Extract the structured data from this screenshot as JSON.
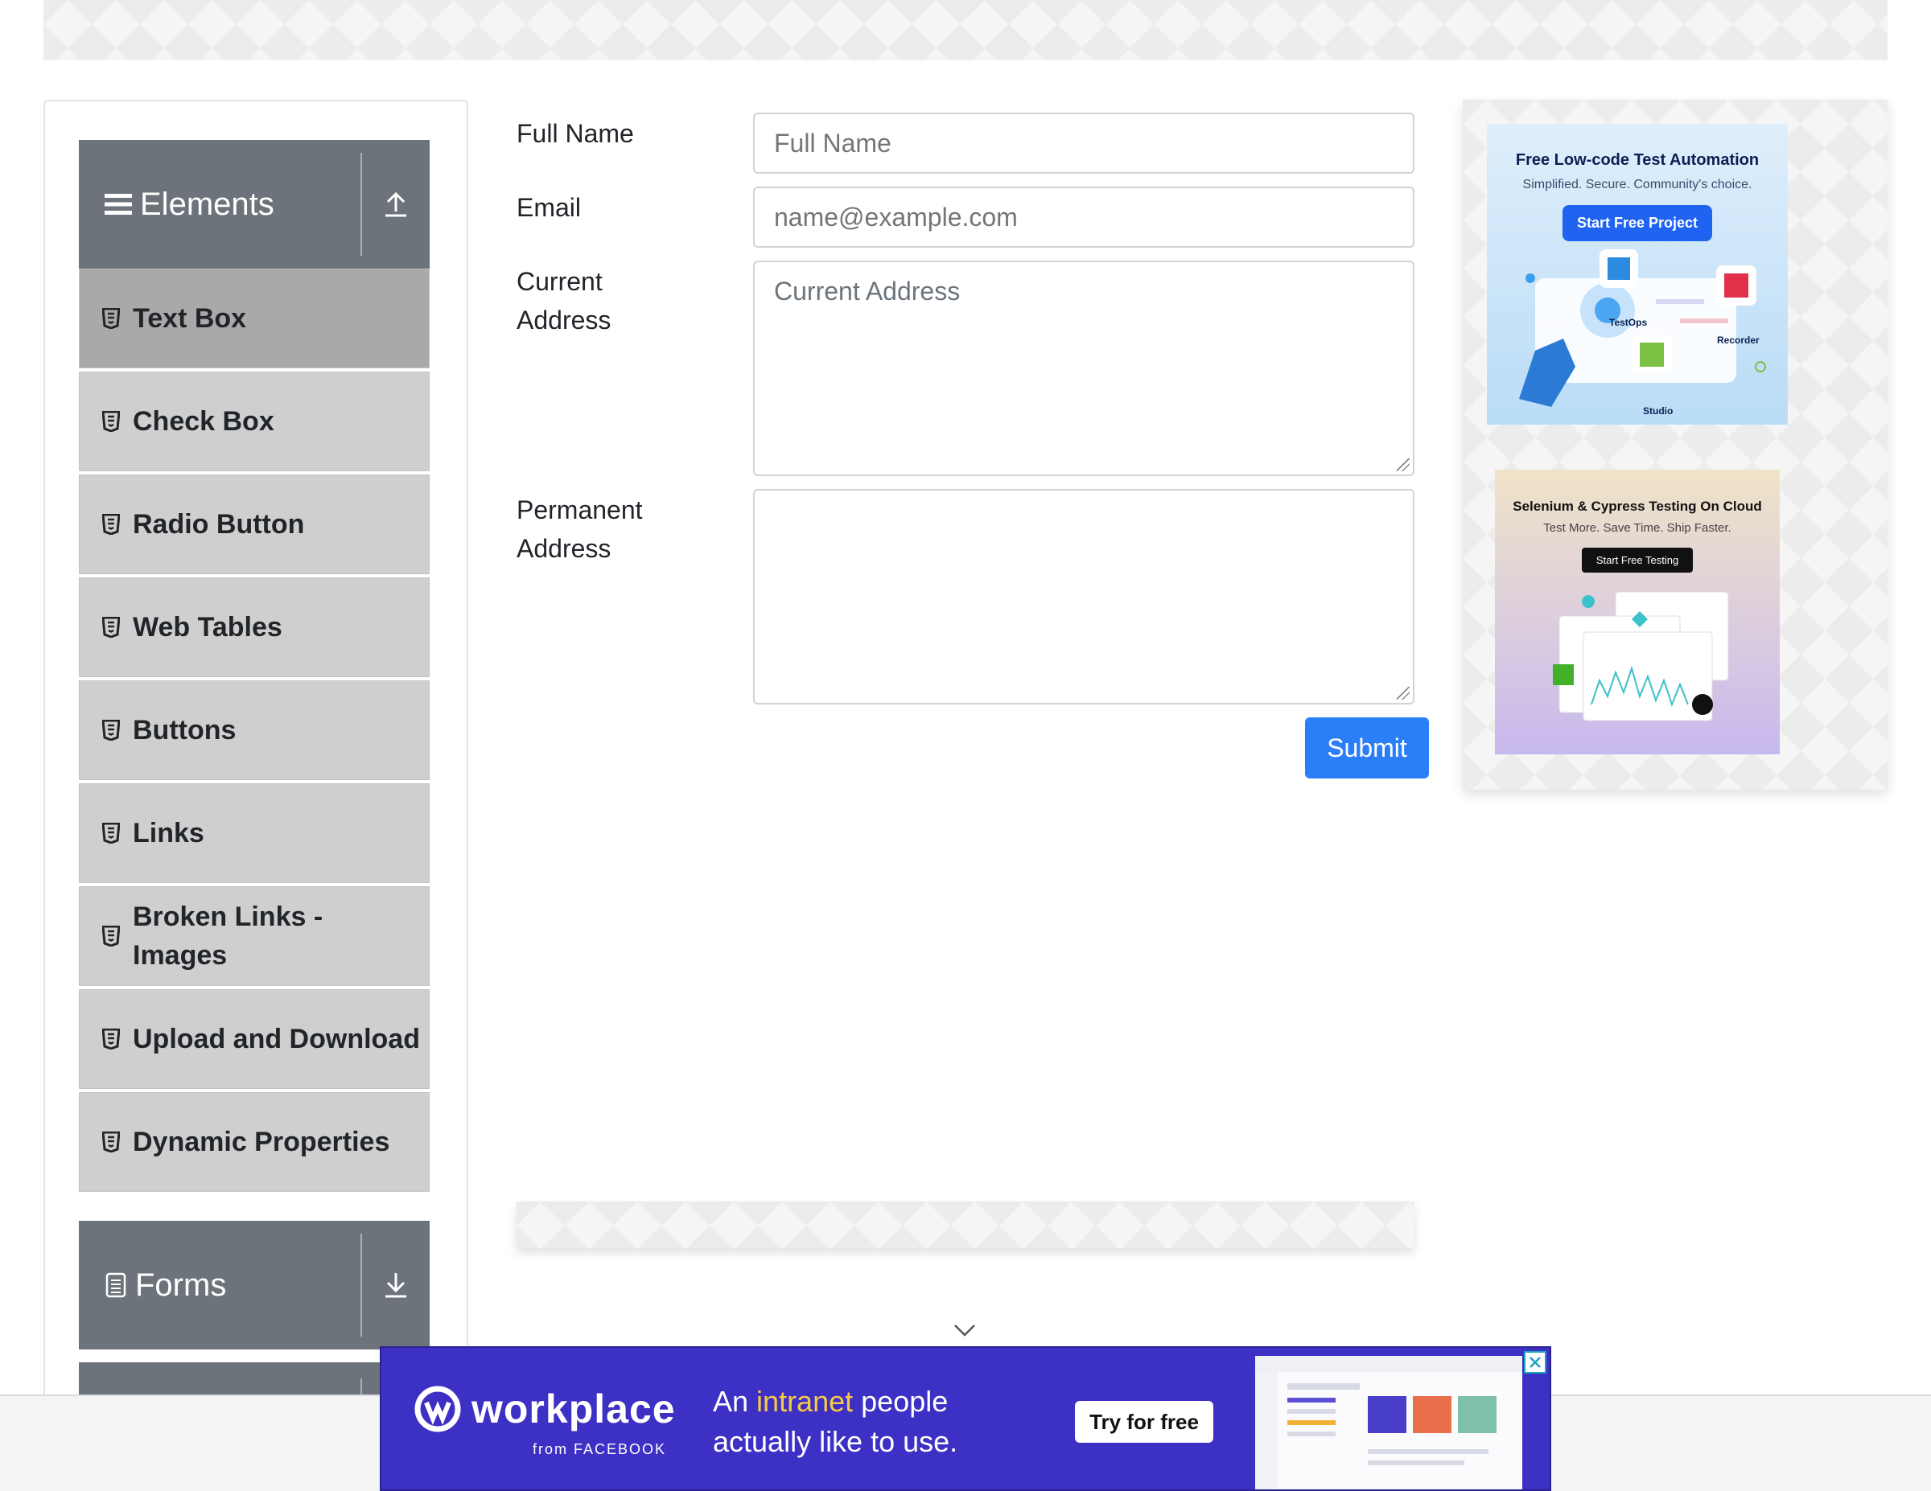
{
  "sidebar": {
    "elements_header": {
      "title": "Elements"
    },
    "items": [
      {
        "label": "Text Box"
      },
      {
        "label": "Check Box"
      },
      {
        "label": "Radio Button"
      },
      {
        "label": "Web Tables"
      },
      {
        "label": "Buttons"
      },
      {
        "label": "Links"
      },
      {
        "label": "Broken Links - Images"
      },
      {
        "label": "Upload and Download"
      },
      {
        "label": "Dynamic Properties"
      }
    ],
    "forms_header": {
      "title": "Forms"
    }
  },
  "form": {
    "full_name": {
      "label": "Full Name",
      "placeholder": "Full Name",
      "value": ""
    },
    "email": {
      "label": "Email",
      "placeholder": "name@example.com",
      "value": ""
    },
    "current_address": {
      "label": "Current Address",
      "placeholder": "Current Address",
      "value": ""
    },
    "permanent_address": {
      "label": "Permanent Address",
      "placeholder": "",
      "value": ""
    },
    "submit_label": "Submit"
  },
  "ads": {
    "katalon": {
      "title": "Free Low-code Test Automation",
      "subtitle": "Simplified. Secure. Community's choice.",
      "cta": "Start Free Project",
      "labels": [
        "TestOps",
        "Recorder",
        "Studio"
      ]
    },
    "lambdatest": {
      "title": "Selenium & Cypress Testing On Cloud",
      "subtitle": "Test More. Save Time. Ship Faster.",
      "cta": "Start Free Testing"
    },
    "workplace": {
      "brand": "workplace",
      "from": "from FACEBOOK",
      "tagline_before": "An ",
      "tagline_highlight": "intranet",
      "tagline_after": " people",
      "tagline_line2": "actually like to use.",
      "cta": "Try for free"
    }
  },
  "colors": {
    "group_header": "#6c737a",
    "menu_item": "#cfcfcf",
    "menu_item_active": "#a9a9a9",
    "submit": "#2a7ef8",
    "workplace": "#3d30c4"
  }
}
